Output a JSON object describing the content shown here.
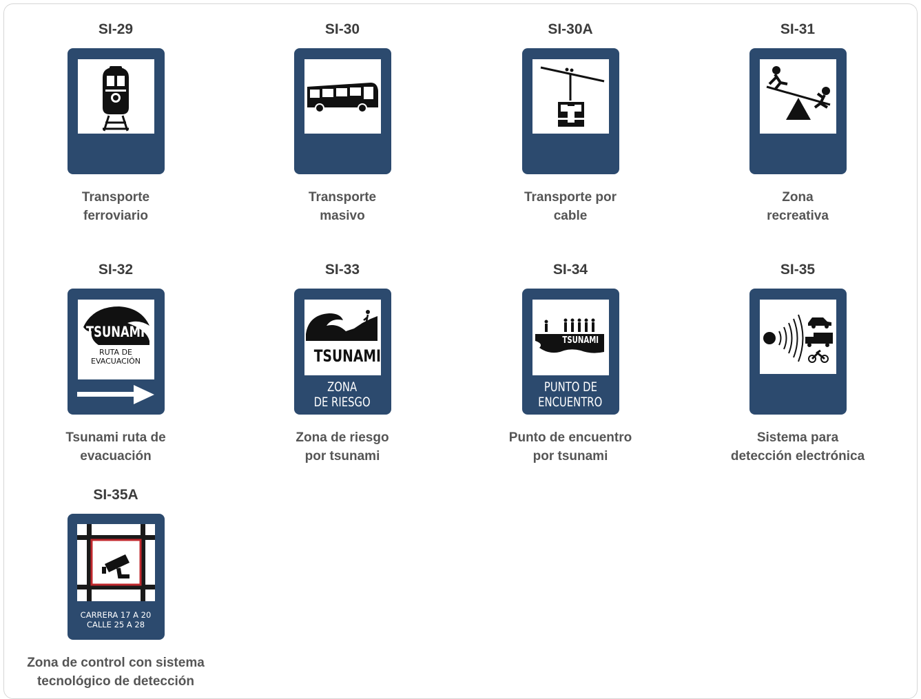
{
  "signs": [
    {
      "code": "SI-29",
      "caption_1": "Transporte",
      "caption_2": "ferroviario",
      "icon": "train-icon"
    },
    {
      "code": "SI-30",
      "caption_1": "Transporte",
      "caption_2": "masivo",
      "icon": "bus-icon"
    },
    {
      "code": "SI-30A",
      "caption_1": "Transporte por",
      "caption_2": "cable",
      "icon": "cable-car-icon"
    },
    {
      "code": "SI-31",
      "caption_1": "Zona",
      "caption_2": "recreativa",
      "icon": "seesaw-icon"
    },
    {
      "code": "SI-32",
      "caption_1": "Tsunami ruta de",
      "caption_2": "evacuación",
      "icon": "tsunami-wave-icon",
      "sign_text": {
        "word": "TSUNAMI",
        "line1": "RUTA DE",
        "line2": "EVACUACIÓN"
      }
    },
    {
      "code": "SI-33",
      "caption_1": "Zona de riesgo",
      "caption_2": "por tsunami",
      "icon": "tsunami-wave-icon",
      "sign_text": {
        "word": "TSUNAMI",
        "line1": "ZONA",
        "line2": "DE RIESGO"
      }
    },
    {
      "code": "SI-34",
      "caption_1": "Punto de encuentro",
      "caption_2": "por tsunami",
      "icon": "meeting-point-icon",
      "sign_text": {
        "word": "TSUNAMI",
        "line1": "PUNTO DE",
        "line2": "ENCUENTRO"
      }
    },
    {
      "code": "SI-35",
      "caption_1": "Sistema para",
      "caption_2": "detección electrónica",
      "icon": "radar-detection-icon"
    },
    {
      "code": "SI-35A",
      "caption_1": "Zona de control con sistema",
      "caption_2": "tecnológico de detección",
      "icon": "cctv-camera-icon",
      "sign_text": {
        "line1": "CARRERA 17 A 20",
        "line2": "CALLE 25 A 28"
      }
    }
  ],
  "colors": {
    "sign_blue": "#2c4a6e",
    "border_red": "#c0282d",
    "text_gray": "#555555"
  }
}
